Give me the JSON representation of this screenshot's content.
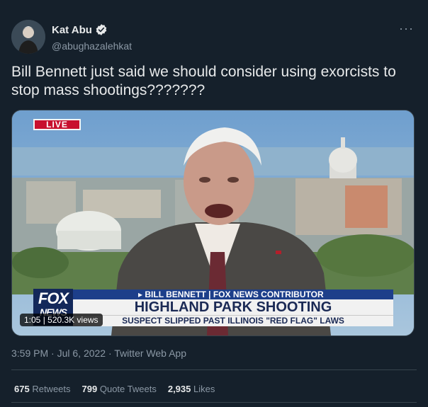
{
  "author": {
    "display_name": "Kat Abu",
    "handle": "@abughazalehkat",
    "verified_icon": "verified-badge-icon"
  },
  "more_icon": "···",
  "tweet_text": "Bill Bennett just said we should consider using exorcists to stop mass shootings???????",
  "video": {
    "live_label": "LIVE",
    "logo_line1": "FOX",
    "logo_line2": "NEWS",
    "chyron_top": "▸ BILL BENNETT | FOX NEWS CONTRIBUTOR",
    "chyron_main": "HIGHLAND PARK SHOOTING",
    "chyron_sub": "SUSPECT SLIPPED PAST ILLINOIS \"RED FLAG\" LAWS",
    "duration": "1:05",
    "views": "520.3K views",
    "colors": {
      "live_red": "#c8102e",
      "chyron_blue": "#1d3f8a",
      "chyron_text": "#1b2a55"
    }
  },
  "meta": {
    "time": "3:59 PM",
    "date": "Jul 6, 2022",
    "source": "Twitter Web App"
  },
  "stats": {
    "retweets_count": "675",
    "retweets_label": "Retweets",
    "quotes_count": "799",
    "quotes_label": "Quote Tweets",
    "likes_count": "2,935",
    "likes_label": "Likes"
  },
  "theme": {
    "background": "#15202b",
    "text": "#e7e9ea",
    "secondary": "#8b98a5",
    "border": "#38444d",
    "verified": "#e7e9ea"
  }
}
